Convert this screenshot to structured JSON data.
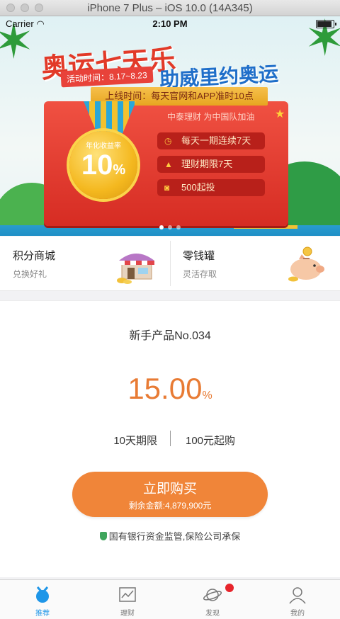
{
  "window": {
    "title": "iPhone 7 Plus – iOS 10.0 (14A345)"
  },
  "status_bar": {
    "carrier": "Carrier",
    "time": "2:10 PM"
  },
  "banner": {
    "title": "奥运七天乐",
    "subtitle": "助威里约奥运",
    "activity_date": "活动时间：8.17~8.23",
    "launch_time": "上线时间：每天官网和APP准时10点",
    "slogan": "中泰理财 为中国队加油",
    "medal_label": "年化收益率",
    "medal_rate": "10",
    "medal_percent": "%",
    "features": [
      "每天一期连续7天",
      "理财期限7天",
      "500起投"
    ],
    "page_count": 3,
    "active_page": 0
  },
  "shortcuts": [
    {
      "title": "积分商城",
      "desc": "兑换好礼",
      "icon": "shop-icon"
    },
    {
      "title": "零钱罐",
      "desc": "灵活存取",
      "icon": "piggy-bank-icon"
    }
  ],
  "product": {
    "name": "新手产品No.034",
    "rate": "15.00",
    "rate_unit": "%",
    "term": "10天期限",
    "min_purchase": "100元起购",
    "buy_label": "立即购买",
    "remaining": "剩余金额:4,879,900元",
    "guarantee": "国有银行资金监管,保险公司承保"
  },
  "tabs": [
    {
      "label": "推荐",
      "icon": "recommend-icon",
      "active": true
    },
    {
      "label": "理财",
      "icon": "chart-icon",
      "active": false
    },
    {
      "label": "发现",
      "icon": "planet-icon",
      "active": false,
      "badge": true
    },
    {
      "label": "我的",
      "icon": "user-icon",
      "active": false
    }
  ],
  "colors": {
    "accent": "#f08539",
    "tab_active": "#1e96e8",
    "banner_red": "#e23a28",
    "badge": "#e7242b"
  }
}
